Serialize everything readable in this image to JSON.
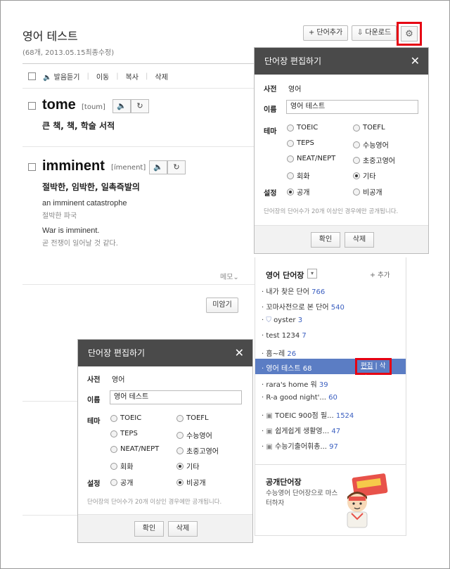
{
  "page": {
    "title": "영어 테스트",
    "subtitle": "(68개, 2013.05.15최종수정)"
  },
  "header_buttons": {
    "add_word": "+ 단어추가",
    "download": "⇩ 다운로드",
    "settings_icon": "gear-icon"
  },
  "toolbar": {
    "listen": "발음듣기",
    "move": "이동",
    "copy": "복사",
    "delete": "삭제"
  },
  "words": [
    {
      "word": "tome",
      "pron": "[toum]",
      "meaning": "큰 책, 책, 학술 서적"
    },
    {
      "word": "imminent",
      "pron": "[ímenent]",
      "meaning": "절박한, 임박한, 일촉즉발의",
      "examples": [
        {
          "en": "an imminent catastrophe",
          "ko": "절박한 파국"
        },
        {
          "en": "War is imminent.",
          "ko": "곧 전쟁이 일어날 것 같다."
        }
      ]
    }
  ],
  "memo_label": "메모⌄",
  "unmemorized_label": "미암기",
  "dialog_top": {
    "title": "단어장 편집하기",
    "close": "✕",
    "dict_label": "사전",
    "dict_value": "영어",
    "name_label": "이름",
    "name_value": "영어 테스트",
    "theme_label": "테마",
    "themes": [
      "TOEIC",
      "TOEFL",
      "TEPS",
      "수능영어",
      "NEAT/NEPT",
      "초중고영어",
      "회화",
      "기타"
    ],
    "selected_theme": "기타",
    "setting_label": "설정",
    "visibility": [
      "공개",
      "비공개"
    ],
    "selected_visibility": "공개",
    "note": "단어장의 단어수가 20개 이상인 경우에만 공개됩니다.",
    "confirm": "확인",
    "delete": "삭제"
  },
  "dialog_bottom": {
    "title": "단어장 편집하기",
    "close": "✕",
    "dict_label": "사전",
    "dict_value": "영어",
    "name_label": "이름",
    "name_value": "영어 테스트",
    "theme_label": "테마",
    "themes": [
      "TOEIC",
      "TOEFL",
      "TEPS",
      "수능영어",
      "NEAT/NEPT",
      "초중고영어",
      "회화",
      "기타"
    ],
    "selected_theme": "기타",
    "setting_label": "설정",
    "visibility": [
      "공개",
      "비공개"
    ],
    "selected_visibility": "비공개",
    "note": "단어장의 단어수가 20개 이상인 경우에만 공개됩니다.",
    "confirm": "확인",
    "delete": "삭제"
  },
  "sidebar": {
    "title": "영어 단어장",
    "add": "+ 추가",
    "items": [
      {
        "prefix": "·",
        "name": "내가 찾은 단어",
        "count": "766"
      },
      {
        "prefix": "·",
        "name": "꼬마사전으로 본 단어",
        "count": "540"
      },
      {
        "prefix": "·",
        "name": "oyster",
        "count": "3"
      },
      {
        "prefix": "·",
        "name": "test 1234",
        "count": "7"
      },
      {
        "prefix": "·",
        "name": "홈~레",
        "count": "26"
      },
      {
        "prefix": "·",
        "name": "영어 테스트",
        "count": "68"
      },
      {
        "prefix": "·",
        "name": "rara's home 워",
        "count": "39"
      },
      {
        "prefix": "·",
        "name": "R-a good night'...",
        "count": "60"
      },
      {
        "prefix": "·",
        "name": "TOEIC 900점 필...",
        "count": "1524"
      },
      {
        "prefix": "·",
        "name": "쉽게쉽게 생활영...",
        "count": "47"
      },
      {
        "prefix": "·",
        "name": "수능기출어휘총...",
        "count": "97"
      }
    ],
    "selected_edit": "편집",
    "selected_delete": "삭제",
    "public_title": "공개단어장",
    "public_sub": "수능영어 단어장으로 마스터하자"
  }
}
